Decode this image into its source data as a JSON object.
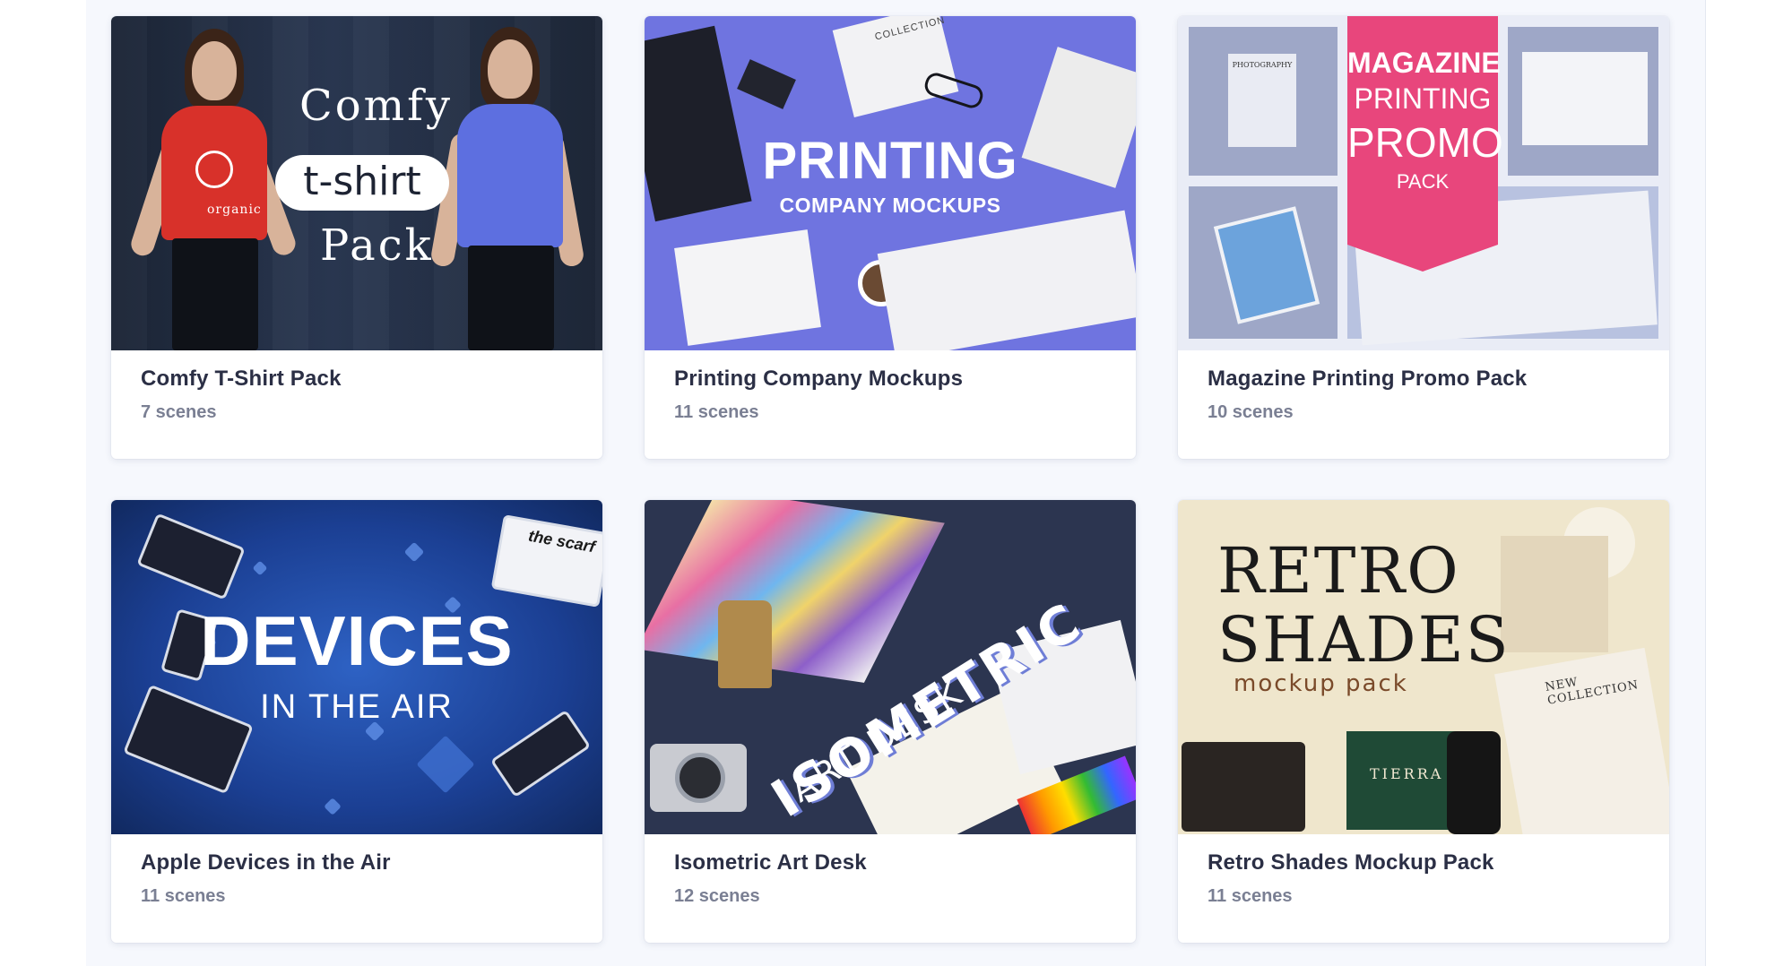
{
  "products": [
    {
      "title": "Comfy T-Shirt Pack",
      "scenes": "7 scenes",
      "art": {
        "line1": "Comfy",
        "line2": "t-shirt",
        "line3": "Pack",
        "brand": "organic"
      }
    },
    {
      "title": "Printing Company Mockups",
      "scenes": "11 scenes",
      "art": {
        "line1": "PRINTING",
        "line2": "COMPANY MOCKUPS",
        "label": "COLLECTION"
      }
    },
    {
      "title": "Magazine Printing Promo Pack",
      "scenes": "10 scenes",
      "art": {
        "line1": "MAGAZINE",
        "line2": "PRINTING",
        "line3": "PROMO",
        "line4": "PACK",
        "label": "PHOTOGRAPHY"
      }
    },
    {
      "title": "Apple Devices in the Air",
      "scenes": "11 scenes",
      "art": {
        "line1": "DEVICES",
        "line2": "IN THE AIR",
        "label": "the scarf"
      }
    },
    {
      "title": "Isometric Art Desk",
      "scenes": "12 scenes",
      "art": {
        "line1": "ISOMETRIC",
        "line2": "ART DESK"
      }
    },
    {
      "title": "Retro Shades Mockup Pack",
      "scenes": "11 scenes",
      "art": {
        "line1": "RETRO",
        "line2": "SHADES",
        "line3": "mockup pack",
        "label": "NEW COLLECTION",
        "brand": "TIERRA"
      }
    }
  ]
}
